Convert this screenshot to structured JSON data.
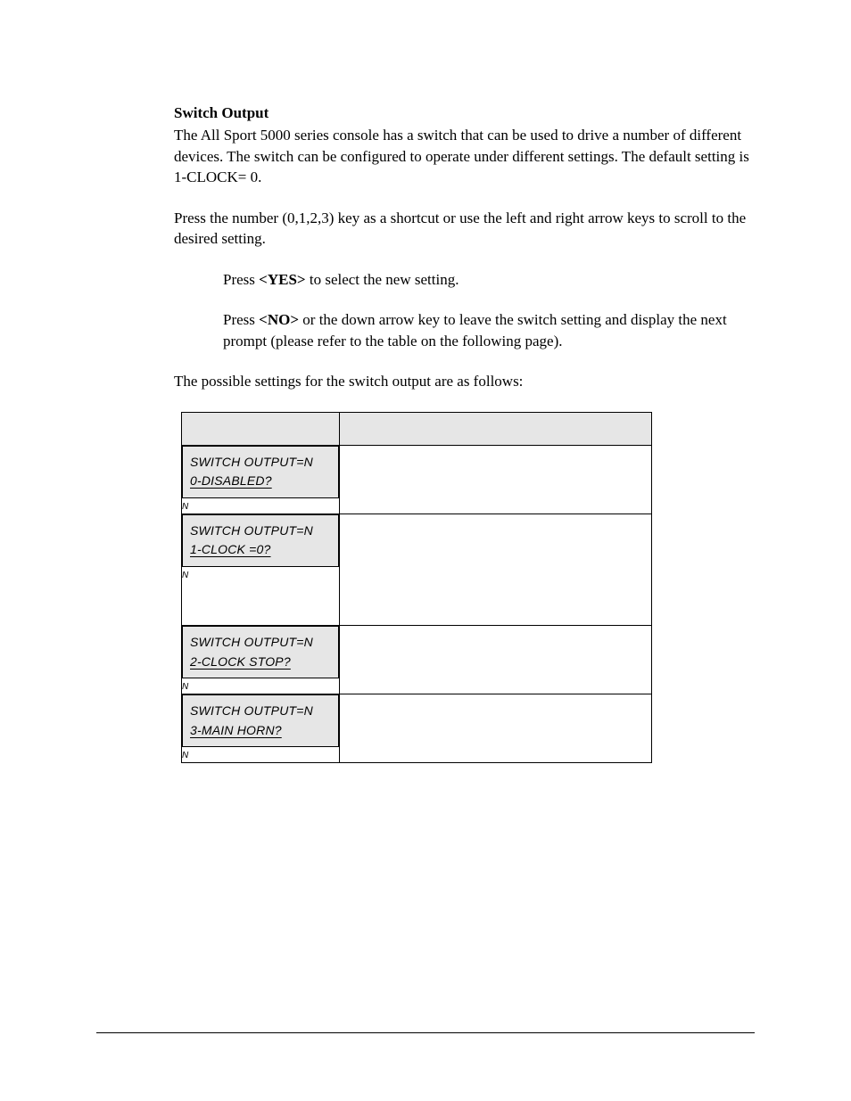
{
  "heading": "Switch Output",
  "intro": "The All Sport 5000 series console has a switch that can be used to drive a number of different devices.  The switch can be configured to operate under different settings. The default setting is 1-CLOCK= 0.",
  "shortcut": "Press the number (0,1,2,3) key as a shortcut or use the left and right arrow keys to scroll to the desired setting.",
  "press_yes_before": "Press ",
  "press_yes_key": "<YES>",
  "press_yes_after": " to select the new setting.",
  "press_no_before": "Press ",
  "press_no_key": "<NO>",
  "press_no_after": " or the down arrow key to leave the switch setting and display the next prompt (please refer to the table on the following page).",
  "possible": "The possible settings for the switch output are as follows:",
  "table": {
    "header_lcd": "",
    "header_desc": "",
    "rows": [
      {
        "line1": "SWITCH OUTPUT=N",
        "line2": "0-DISABLED?",
        "below": "N",
        "desc": ""
      },
      {
        "line1": "SWITCH OUTPUT=N",
        "line2": "1-CLOCK =0?",
        "below": "N",
        "desc": ""
      },
      {
        "line1": "SWITCH OUTPUT=N",
        "line2": "2-CLOCK STOP?",
        "below": "N",
        "desc": ""
      },
      {
        "line1": "SWITCH OUTPUT=N",
        "line2": "3-MAIN HORN?",
        "below": "N",
        "desc": ""
      }
    ]
  }
}
